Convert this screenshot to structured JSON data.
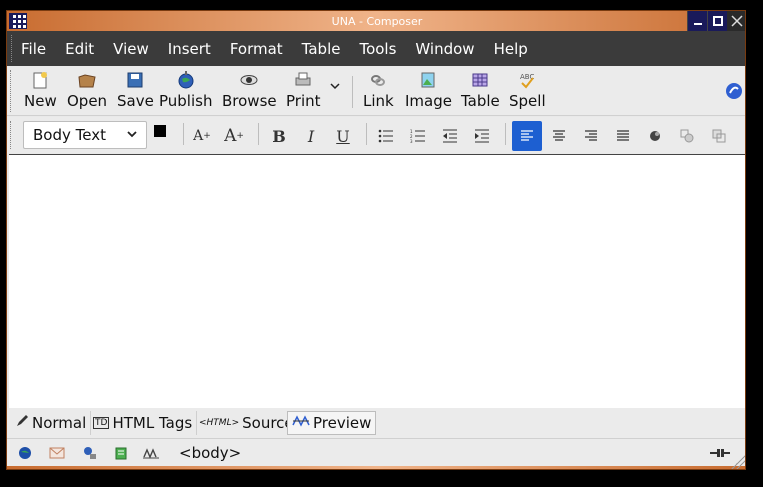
{
  "window": {
    "title": "UNA - Composer",
    "accent": "#c86c30"
  },
  "menubar": {
    "items": [
      "File",
      "Edit",
      "View",
      "Insert",
      "Format",
      "Table",
      "Tools",
      "Window",
      "Help"
    ]
  },
  "toolbar": {
    "buttons": [
      {
        "label": "New",
        "icon": "new-page-icon"
      },
      {
        "label": "Open",
        "icon": "open-folder-icon"
      },
      {
        "label": "Save",
        "icon": "save-disk-icon"
      },
      {
        "label": "Publish",
        "icon": "publish-globe-icon"
      },
      {
        "label": "Browse",
        "icon": "browse-eye-icon"
      },
      {
        "label": "Print",
        "icon": "printer-icon"
      },
      {
        "label": "Link",
        "icon": "link-chain-icon"
      },
      {
        "label": "Image",
        "icon": "image-icon"
      },
      {
        "label": "Table",
        "icon": "table-icon"
      },
      {
        "label": "Spell",
        "icon": "spell-check-icon"
      }
    ]
  },
  "format_toolbar": {
    "paragraph_style": "Body Text",
    "text_color": "#000000",
    "background_color": "#ffffff",
    "active_alignment": "align-left",
    "active_color": "#1d5fd1"
  },
  "tabs": [
    {
      "label": "Normal",
      "icon": "pen-icon"
    },
    {
      "label": "HTML Tags",
      "icon": "td-tag-icon"
    },
    {
      "label": "Source",
      "icon": "html-tag-icon"
    },
    {
      "label": "Preview",
      "icon": "preview-icon",
      "active": true
    }
  ],
  "statusbar": {
    "path": "<body>"
  }
}
